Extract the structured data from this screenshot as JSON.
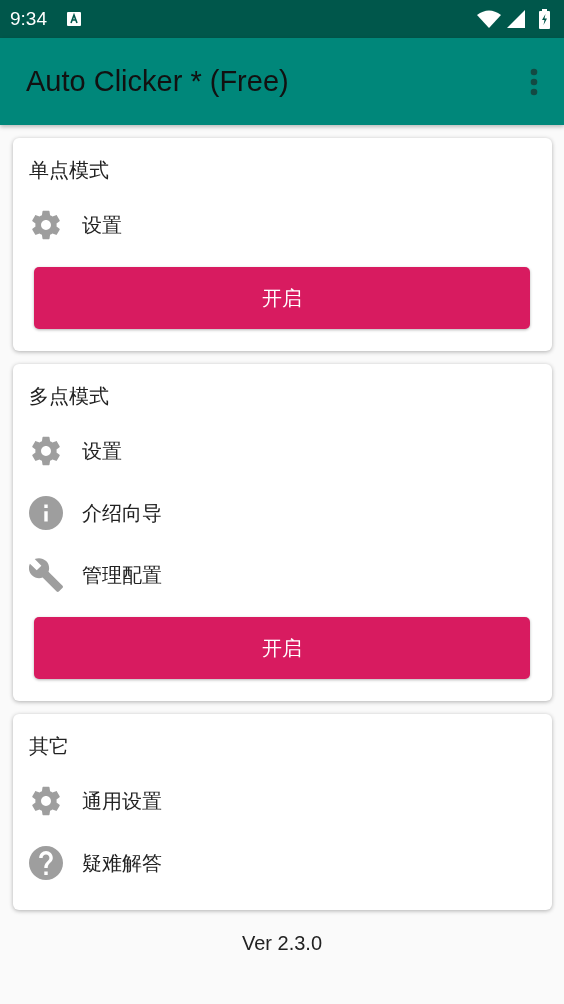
{
  "status_bar": {
    "time": "9:34"
  },
  "app_bar": {
    "title": "Auto Clicker * (Free)"
  },
  "cards": [
    {
      "title": "单点模式",
      "items": [
        {
          "kind": "gear",
          "label": "设置"
        }
      ],
      "button": "开启"
    },
    {
      "title": "多点模式",
      "items": [
        {
          "kind": "gear",
          "label": "设置"
        },
        {
          "kind": "info",
          "label": "介绍向导"
        },
        {
          "kind": "wrench",
          "label": "管理配置"
        }
      ],
      "button": "开启"
    },
    {
      "title": "其它",
      "items": [
        {
          "kind": "gear",
          "label": "通用设置"
        },
        {
          "kind": "help",
          "label": "疑难解答"
        }
      ]
    }
  ],
  "version": "Ver 2.3.0"
}
